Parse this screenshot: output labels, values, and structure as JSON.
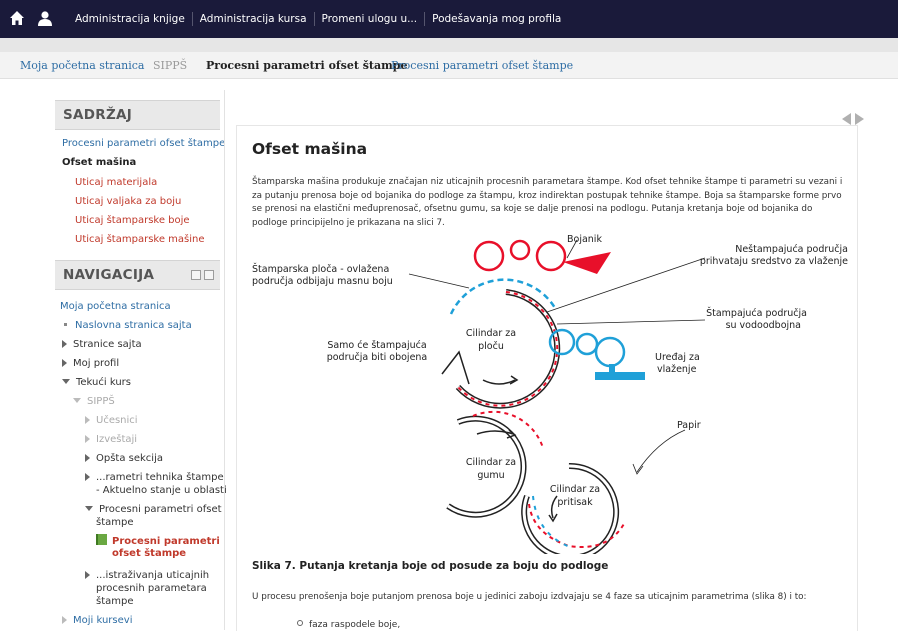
{
  "topnav": {
    "items": [
      "Administracija knjige",
      "Administracija kursa",
      "Promeni ulogu u...",
      "Podešavanja mog profila"
    ]
  },
  "breadcrumb": {
    "home": "Moja početna stranica",
    "course": "SIPPŠ",
    "section": "Procesni parametri ofset štampe",
    "book": "Procesni parametri ofset štampe"
  },
  "toc": {
    "title": "SADRŽAJ",
    "items": [
      "Procesni parametri ofset štampe",
      "Ofset mašina",
      "Uticaj materijala",
      "Uticaj valjaka za boju",
      "Uticaj štamparske boje",
      "Uticaj štamparske mašine"
    ]
  },
  "navigation": {
    "title": "NAVIGACIJA",
    "home": "Moja početna stranica",
    "site_home": "Naslovna stranica sajta",
    "site_pages": "Stranice sajta",
    "my_profile": "Moj profil",
    "current_course": "Tekući kurs",
    "course_code": "SIPPŠ",
    "participants": "Učesnici",
    "reports": "Izveštaji",
    "general": "Opšta sekcija",
    "section1_line1": "...rametri tehnika štampe",
    "section1_line2": "- Aktuelno stanje u oblasti",
    "section2_line1": "Procesni parametri ofset",
    "section2_line2": "štampe",
    "book_line1": "Procesni parametri",
    "book_line2": "ofset štampe",
    "section3_line1": "...istraživanja uticajnih",
    "section3_line2": "procesnih parametara",
    "section3_line3": "štampe",
    "my_courses": "Moji kursevi"
  },
  "content": {
    "heading": "Ofset mašina",
    "intro": "Štamparska mašina produkuje značajan niz uticajnih procesnih parametara štampe. Kod ofset tehnike štampe ti parametri su vezani i za putanju prenosa boje od bojanika do podloge za štampu, kroz indirektan postupak tehnike štampe. Boja sa štamparske forme prvo se prenosi na elastični međuprenosač, ofsetnu gumu, sa koje se dalje prenosi na podlogu. Putanja kretanja boje od bojanika do podloge principijelno je prikazana na slici 7.",
    "caption": "Slika 7.  Putanja kretanja boje od posude za boju do podloge",
    "para2": "U procesu prenošenja boje putanjom prenosa boje u jedinici zaboju izdvajaju se 4 faze sa uticajnim parametrima (slika 8) i to:",
    "bullet1": "faza raspodele boje,"
  },
  "diagram": {
    "bojanik": "Bojanik",
    "plate_l1": "Štamparska ploča - ovlažena",
    "plate_l2": "područja odbijaju masnu boju",
    "nonprint_l1": "Neštampajuća područja",
    "nonprint_l2": "prihvataju sredstvo za vlaženje",
    "print_l1": "Štampajuća područja",
    "print_l2": "su vodoodbojna",
    "only_l1": "Samo će štampajuća",
    "only_l2": "područja biti obojena",
    "plate_cyl_l1": "Cilindar za",
    "plate_cyl_l2": "ploču",
    "damp_l1": "Uređaj za",
    "damp_l2": "vlaženje",
    "blanket_l1": "Cilindar za",
    "blanket_l2": "gumu",
    "papir": "Papir",
    "impress_l1": "Cilindar za",
    "impress_l2": "pritisak",
    "colors": {
      "ink": "#e8102a",
      "water": "#1fa0d8"
    }
  }
}
